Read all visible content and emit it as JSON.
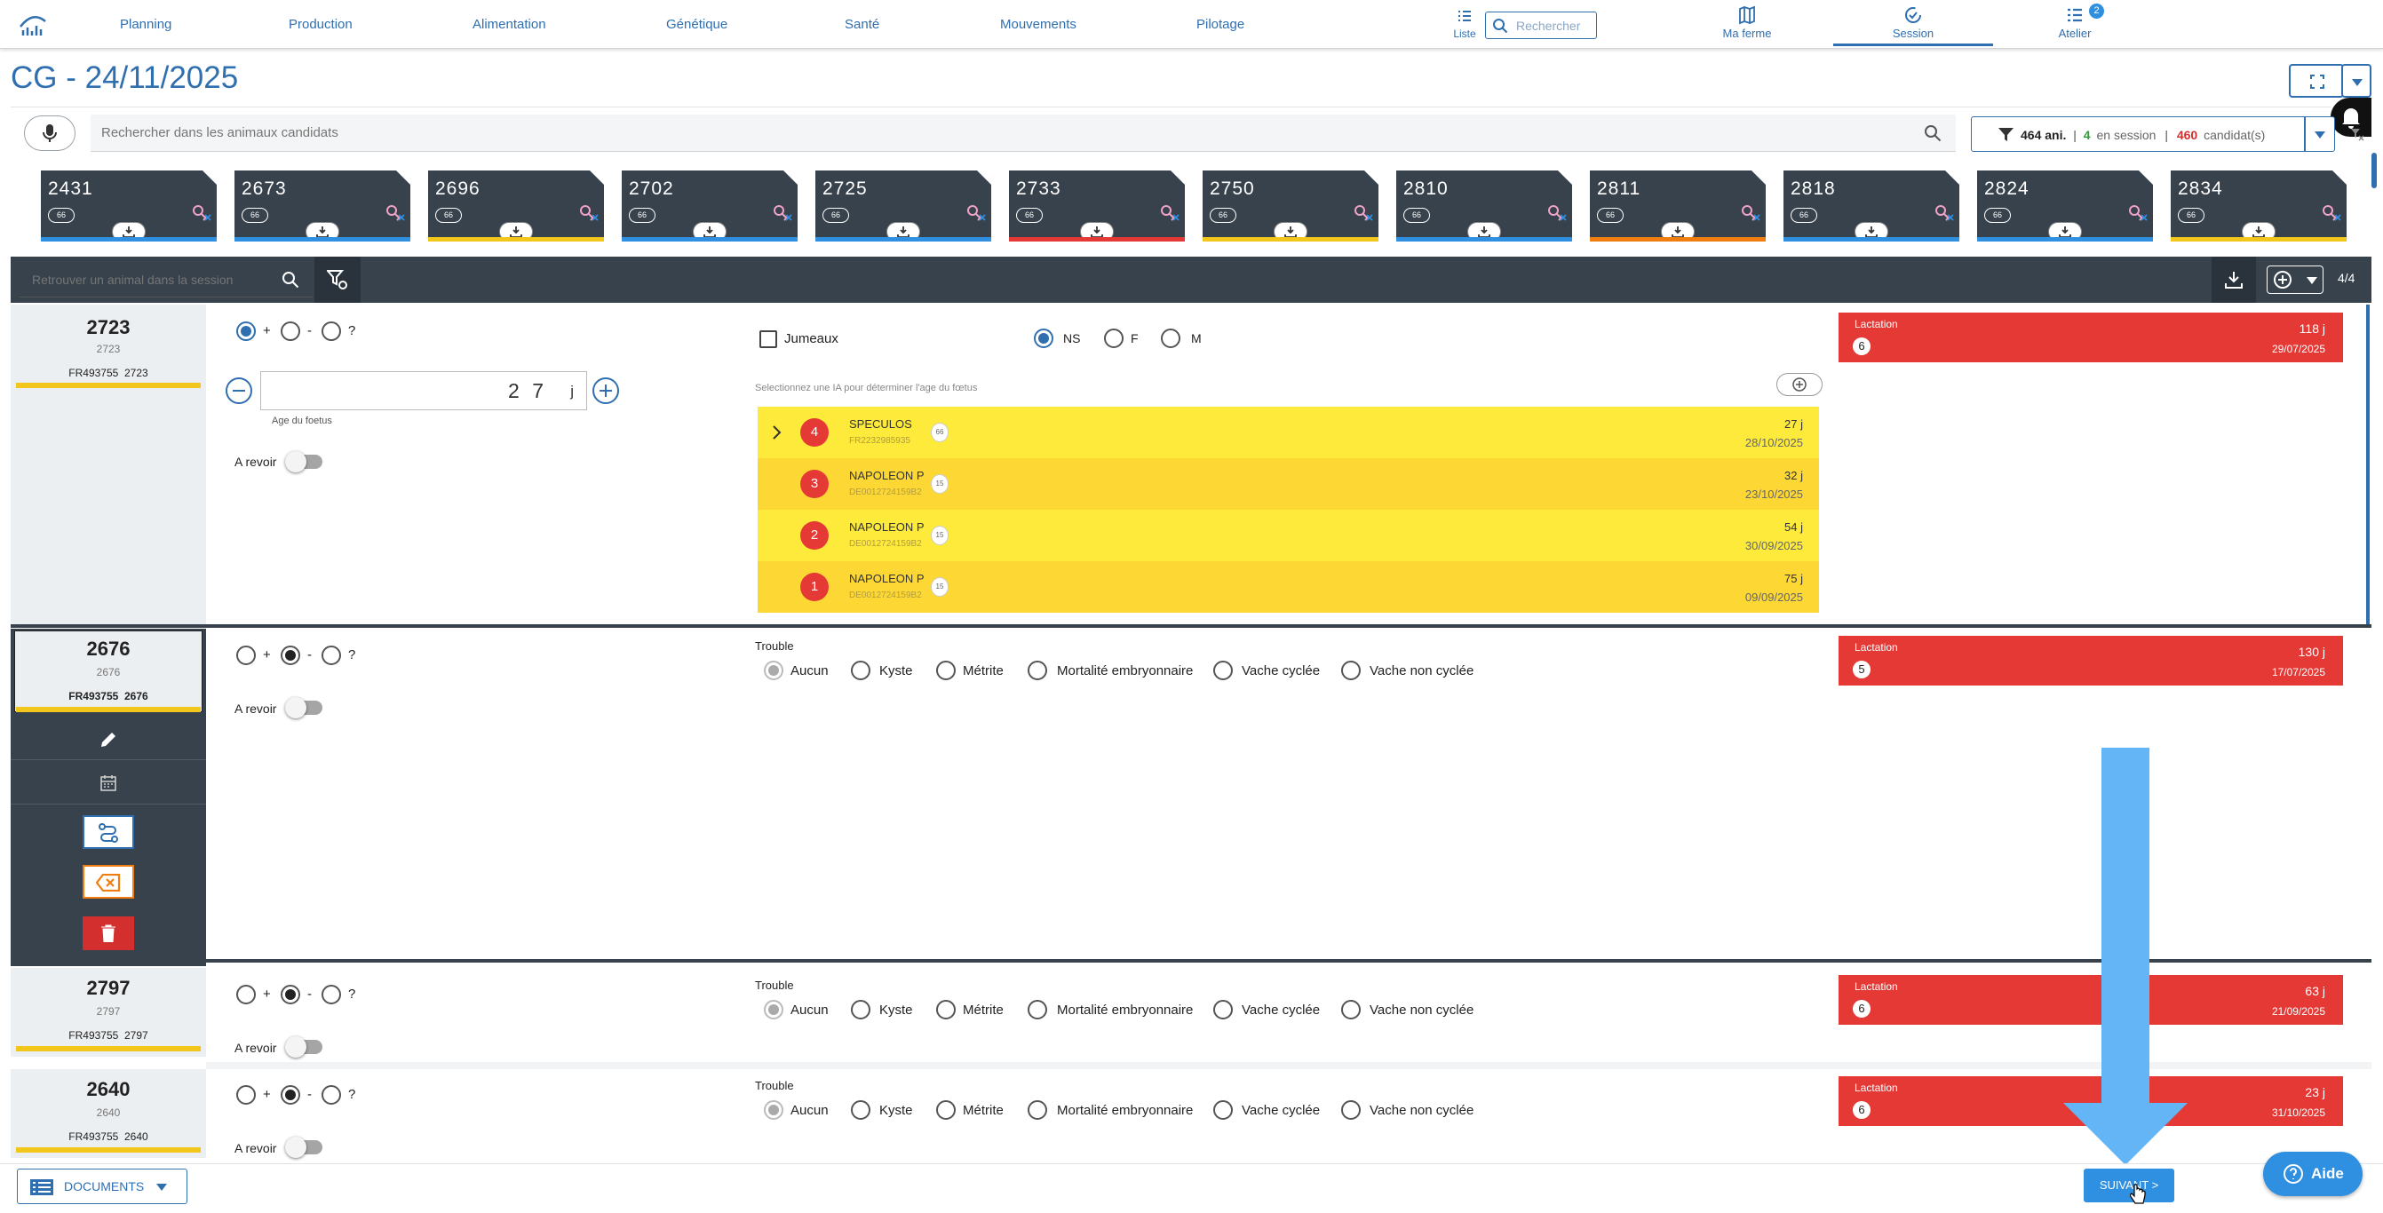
{
  "nav": {
    "items": [
      "Planning",
      "Production",
      "Alimentation",
      "Génétique",
      "Santé",
      "Mouvements",
      "Pilotage"
    ],
    "liste": "Liste",
    "search_placeholder": "Rechercher",
    "ma_ferme": "Ma ferme",
    "session": "Session",
    "atelier": "Atelier",
    "atelier_badge": "2"
  },
  "page": {
    "title": "CG - 24/11/2025"
  },
  "candidates": {
    "search_placeholder": "Rechercher dans les animaux candidats",
    "filter": {
      "animals": "464 ani.",
      "sep1": "|",
      "in_session_count": "4",
      "in_session_label": "en session",
      "sep2": "|",
      "candidates_count": "460",
      "candidates_label": "candidat(s)"
    },
    "cards": [
      {
        "num": "2431",
        "pill": "66",
        "stripe": "#2f8fe0"
      },
      {
        "num": "2673",
        "pill": "66",
        "stripe": "#2f8fe0"
      },
      {
        "num": "2696",
        "pill": "66",
        "stripe": "#f3c61b"
      },
      {
        "num": "2702",
        "pill": "66",
        "stripe": "#2f8fe0"
      },
      {
        "num": "2725",
        "pill": "66",
        "stripe": "#2f8fe0"
      },
      {
        "num": "2733",
        "pill": "66",
        "stripe": "#e53935"
      },
      {
        "num": "2750",
        "pill": "66",
        "stripe": "#f3c61b"
      },
      {
        "num": "2810",
        "pill": "66",
        "stripe": "#2f8fe0"
      },
      {
        "num": "2811",
        "pill": "66",
        "stripe": "#ef7d10"
      },
      {
        "num": "2818",
        "pill": "66",
        "stripe": "#2f8fe0"
      },
      {
        "num": "2824",
        "pill": "66",
        "stripe": "#2f8fe0"
      },
      {
        "num": "2834",
        "pill": "66",
        "stripe": "#f3c61b"
      }
    ]
  },
  "session": {
    "search_placeholder": "Retrouver un animal dans la session",
    "count": "4/4"
  },
  "row1": {
    "num": "2723",
    "sub": "2723",
    "fr": "FR493755",
    "fr_num": "2723",
    "r_plus": "+",
    "r_minus": "-",
    "r_q": "?",
    "stepper_value": "2 7",
    "stepper_unit": "j",
    "stepper_label": "Age du foetus",
    "a_revoir": "A revoir",
    "jumeaux": "Jumeaux",
    "sex_ns": "NS",
    "sex_f": "F",
    "sex_m": "M",
    "ia_hint": "Selectionnez une IA pour déterminer l'age du fœtus",
    "ia_rows": [
      {
        "badge": "4",
        "name": "SPECULOS",
        "code": "FR2232985935",
        "egg": "66",
        "days": "27 j",
        "date": "28/10/2025",
        "bg": "#fdea3b"
      },
      {
        "badge": "3",
        "name": "NAPOLEON P",
        "code": "DE0012724159B2",
        "egg": "15",
        "days": "32 j",
        "date": "23/10/2025",
        "bg": "#fdd835"
      },
      {
        "badge": "2",
        "name": "NAPOLEON P",
        "code": "DE0012724159B2",
        "egg": "15",
        "days": "54 j",
        "date": "30/09/2025",
        "bg": "#fdea3b"
      },
      {
        "badge": "1",
        "name": "NAPOLEON P",
        "code": "DE0012724159B2",
        "egg": "15",
        "days": "75 j",
        "date": "09/09/2025",
        "bg": "#fdd835"
      }
    ],
    "lact": {
      "title": "Lactation",
      "num": "6",
      "days": "118 j",
      "date": "29/07/2025"
    }
  },
  "trouble": {
    "title": "Trouble",
    "options": [
      "Aucun",
      "Kyste",
      "Métrite",
      "Mortalité embryonnaire",
      "Vache cyclée",
      "Vache non cyclée"
    ]
  },
  "row2": {
    "num": "2676",
    "sub": "2676",
    "fr": "FR493755",
    "fr_num": "2676",
    "a_revoir": "A revoir",
    "lact": {
      "title": "Lactation",
      "num": "5",
      "days": "130 j",
      "date": "17/07/2025"
    }
  },
  "row3": {
    "num": "2797",
    "sub": "2797",
    "fr": "FR493755",
    "fr_num": "2797",
    "a_revoir": "A revoir",
    "lact": {
      "title": "Lactation",
      "num": "6",
      "days": "63 j",
      "date": "21/09/2025"
    }
  },
  "row4": {
    "num": "2640",
    "sub": "2640",
    "fr": "FR493755",
    "fr_num": "2640",
    "a_revoir": "A revoir",
    "lact": {
      "title": "Lactation",
      "num": "6",
      "days": "23 j",
      "date": "31/10/2025"
    }
  },
  "footer": {
    "documents": "DOCUMENTS",
    "suivant": "SUIVANT >",
    "aide": "Aide"
  }
}
